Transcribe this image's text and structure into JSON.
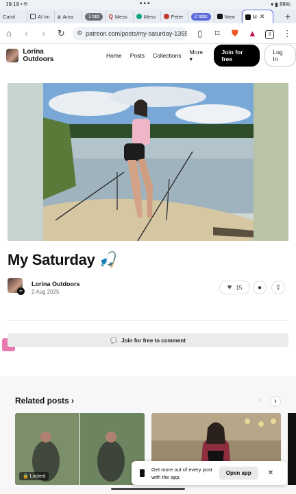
{
  "status_bar": {
    "time": "19:18",
    "battery": "89%"
  },
  "tabs": [
    {
      "label": "Carol",
      "icon": "generic-tab-icon",
      "color": "#c9c9c9"
    },
    {
      "label": "AI Im",
      "icon": "grid-icon",
      "color": "#333333"
    },
    {
      "label": "Ama",
      "icon": "amazon-icon",
      "color": "#222222"
    },
    {
      "group_label": "1 tab"
    },
    {
      "label": "Mess",
      "icon": "quora-icon",
      "color": "#b92b27"
    },
    {
      "label": "Mess",
      "icon": "chatgpt-icon",
      "color": "#0fa37f"
    },
    {
      "label": "Peter",
      "icon": "circle-icon",
      "color": "#c0392b"
    },
    {
      "group_label": "2 tabs"
    },
    {
      "label": "New",
      "icon": "patreon-icon",
      "color": "#111111"
    },
    {
      "label": "M",
      "icon": "patreon-icon",
      "color": "#111111",
      "active": true
    }
  ],
  "toolbar": {
    "url": "patreon.com/posts/my-saturday-1355(",
    "tab_count": "8"
  },
  "site": {
    "creator_name": "Lorina Outdoors",
    "nav": [
      "Home",
      "Posts",
      "Collections",
      "More"
    ],
    "join_label": "Join for free",
    "login_label": "Log In"
  },
  "post": {
    "title": "My Saturday 🎣",
    "author": "Lorina Outdoors",
    "date": "2 Aug 2025",
    "likes": "15",
    "comment_prompt": "Join for free to comment"
  },
  "related": {
    "title": "Related posts",
    "cards": [
      {
        "badge": "Locked"
      },
      {
        "badge": ""
      }
    ]
  },
  "app_banner": {
    "line1": "Get more out of every post",
    "line2": "with the app.",
    "button": "Open app"
  }
}
